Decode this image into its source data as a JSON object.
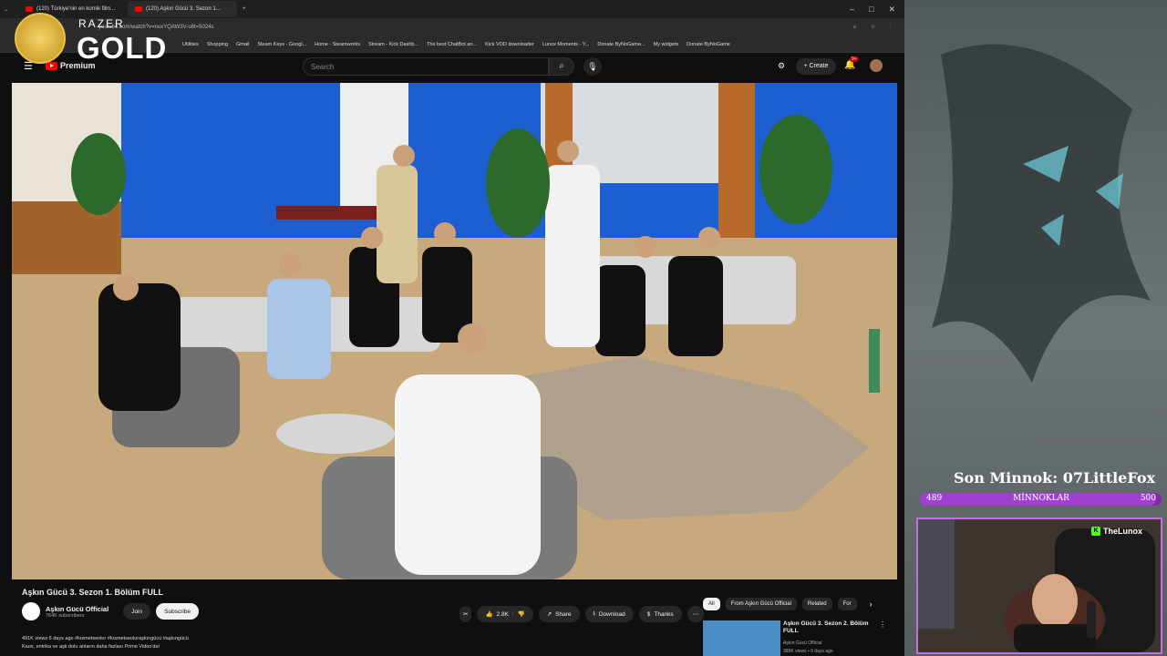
{
  "tabs": [
    {
      "label": "(120) Türkiye'nin en komik film..."
    },
    {
      "label": "(120) Aşkın Gücü 3. Sezon 1..."
    }
  ],
  "address": {
    "url": "youtube.com/watch?v=nuxYQAW3V-o8t=5024s"
  },
  "bookmarks": [
    "Utilities",
    "Shopping",
    "Gmail",
    "Steam Keys - Googl...",
    "Home - Steamworks",
    "Stream - Kick Dashb...",
    "The best ChatBot an...",
    "Kick VOD downloader",
    "Lunox Moments - Y...",
    "Donate ByNoGame...",
    "My widgets",
    "Donate ByNoGame"
  ],
  "overlay": {
    "razer": "RAZER",
    "gold": "GOLD"
  },
  "youtube": {
    "premium": "Premium",
    "search_placeholder": "Search",
    "create": "Create",
    "notif": "9+"
  },
  "video": {
    "title": "Aşkın Gücü 3. Sezon 1. Bölüm FULL",
    "channel": "Aşkın Gücü Official",
    "subscribers": "764K subscribers",
    "join": "Join",
    "subscribe": "Subscribe",
    "likes": "2.8K",
    "share": "Share",
    "download": "Download",
    "thanks": "Thanks",
    "desc_line1": "491K views  6 days ago  #kısmetseolur #kısmetseoluraşkıngücü #aşkıngücü",
    "desc_line2": "Kaos, entrika ve aşk dolu anların daha fazlası Prime Video'da!"
  },
  "chips": [
    "All",
    "From Aşkın Gücü Official",
    "Related",
    "For"
  ],
  "recommended": {
    "title": "Aşkın Gücü 3. Sezon 2. Bölüm FULL",
    "channel": "Aşkın Gücü Official",
    "views": "389K views • 6 days ago"
  },
  "stream": {
    "last_sub": "Son Minnok: 07LittleFox",
    "goal_current": "489",
    "goal_label": "MİNNOKLAR",
    "goal_target": "500",
    "goal_fraction": 0.978,
    "streamer": "TheLunox"
  },
  "colors": {
    "accent": "#ff0000",
    "goal_bar": "#a040d0",
    "kick_green": "#53fc18"
  }
}
